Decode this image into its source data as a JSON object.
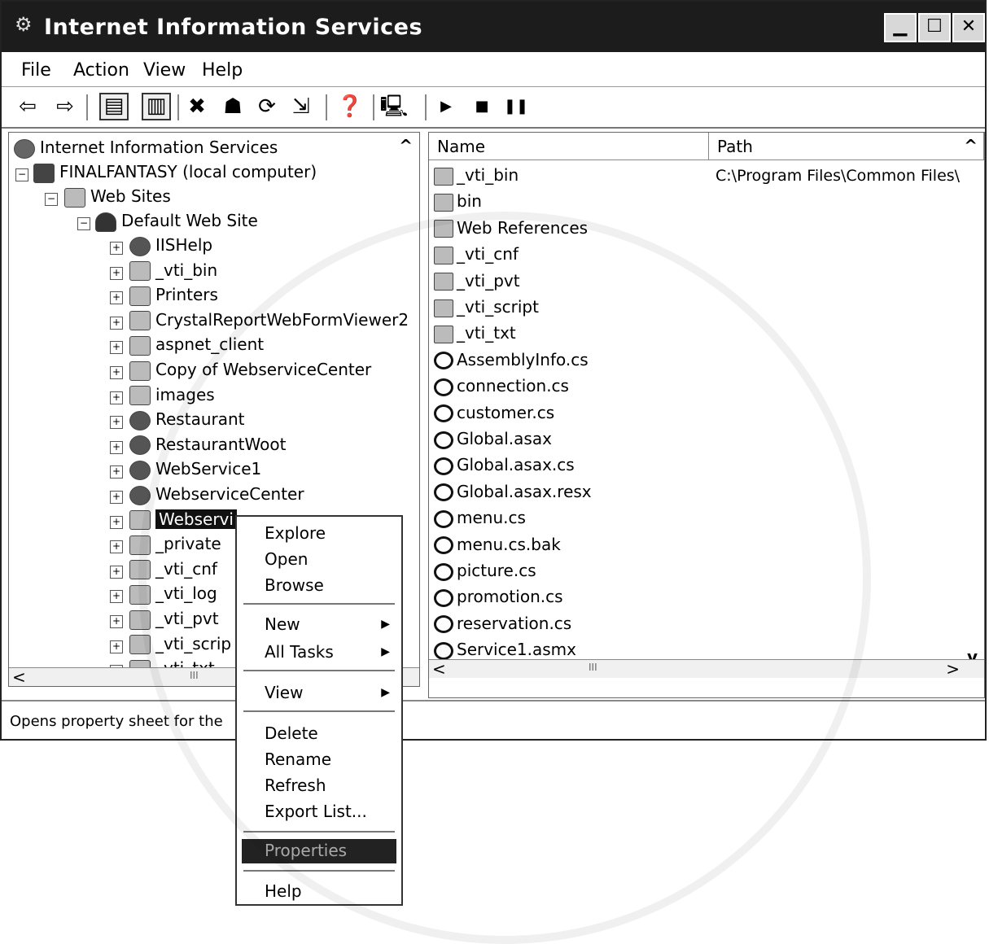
{
  "window": {
    "title": "Internet Information Services",
    "controls": {
      "minimize": "▁",
      "maximize": "☐",
      "close": "✕"
    }
  },
  "menu": [
    "File",
    "Action",
    "View",
    "Help"
  ],
  "toolbar": {
    "back": "⇦",
    "forward": "⇨",
    "up": "▤",
    "show_hide": "▥",
    "delete": "✖",
    "properties": "☗",
    "refresh": "⟳",
    "export": "⇲",
    "help": "❓",
    "computer": "🖳",
    "play": "▶",
    "stop": "■",
    "pause": "❚❚"
  },
  "tree": {
    "root": "Internet Information Services",
    "computer": "FINALFANTASY (local computer)",
    "web_sites": "Web Sites",
    "default_site": "Default Web Site",
    "children": [
      {
        "label": "IISHelp",
        "icon": "globe"
      },
      {
        "label": "_vti_bin",
        "icon": "folder"
      },
      {
        "label": "Printers",
        "icon": "folder"
      },
      {
        "label": "CrystalReportWebFormViewer2",
        "icon": "folder"
      },
      {
        "label": "aspnet_client",
        "icon": "folder"
      },
      {
        "label": "Copy of WebserviceCenter",
        "icon": "folder"
      },
      {
        "label": "images",
        "icon": "folder"
      },
      {
        "label": "Restaurant",
        "icon": "globe"
      },
      {
        "label": "RestaurantWoot",
        "icon": "globe"
      },
      {
        "label": "WebService1",
        "icon": "globe"
      },
      {
        "label": "WebserviceCenter",
        "icon": "globe"
      },
      {
        "label": "Webservi",
        "icon": "folder"
      },
      {
        "label": "_private",
        "icon": "folder"
      },
      {
        "label": "_vti_cnf",
        "icon": "folder"
      },
      {
        "label": "_vti_log",
        "icon": "folder"
      },
      {
        "label": "_vti_pvt",
        "icon": "folder"
      },
      {
        "label": "_vti_scrip",
        "icon": "folder"
      },
      {
        "label": "_vti_txt",
        "icon": "folder"
      }
    ],
    "scroll_thumb": "III"
  },
  "list": {
    "columns": [
      "Name",
      "Path"
    ],
    "rows": [
      {
        "name": "_vti_bin",
        "path": "C:\\Program Files\\Common Files\\",
        "icon": "folder"
      },
      {
        "name": "bin",
        "path": "",
        "icon": "folder"
      },
      {
        "name": "Web References",
        "path": "",
        "icon": "folder"
      },
      {
        "name": "_vti_cnf",
        "path": "",
        "icon": "folder"
      },
      {
        "name": "_vti_pvt",
        "path": "",
        "icon": "folder"
      },
      {
        "name": "_vti_script",
        "path": "",
        "icon": "folder"
      },
      {
        "name": "_vti_txt",
        "path": "",
        "icon": "folder"
      },
      {
        "name": "AssemblyInfo.cs",
        "path": "",
        "icon": "file"
      },
      {
        "name": "connection.cs",
        "path": "",
        "icon": "file"
      },
      {
        "name": "customer.cs",
        "path": "",
        "icon": "file"
      },
      {
        "name": "Global.asax",
        "path": "",
        "icon": "file"
      },
      {
        "name": "Global.asax.cs",
        "path": "",
        "icon": "file"
      },
      {
        "name": "Global.asax.resx",
        "path": "",
        "icon": "file"
      },
      {
        "name": "menu.cs",
        "path": "",
        "icon": "file"
      },
      {
        "name": "menu.cs.bak",
        "path": "",
        "icon": "file"
      },
      {
        "name": "picture.cs",
        "path": "",
        "icon": "file"
      },
      {
        "name": "promotion.cs",
        "path": "",
        "icon": "file"
      },
      {
        "name": "reservation.cs",
        "path": "",
        "icon": "file"
      },
      {
        "name": "Service1.asmx",
        "path": "",
        "icon": "file"
      }
    ],
    "scroll_thumb": "III"
  },
  "status": "Opens property sheet for the",
  "context_menu": {
    "items": [
      "Explore",
      "Open",
      "Browse",
      "New",
      "All Tasks",
      "View",
      "Delete",
      "Rename",
      "Refresh",
      "Export List...",
      "Properties",
      "Help"
    ],
    "submenu_arrow": "▶"
  },
  "scroll": {
    "left": "<",
    "right": ">",
    "up": "^",
    "down": "v"
  }
}
